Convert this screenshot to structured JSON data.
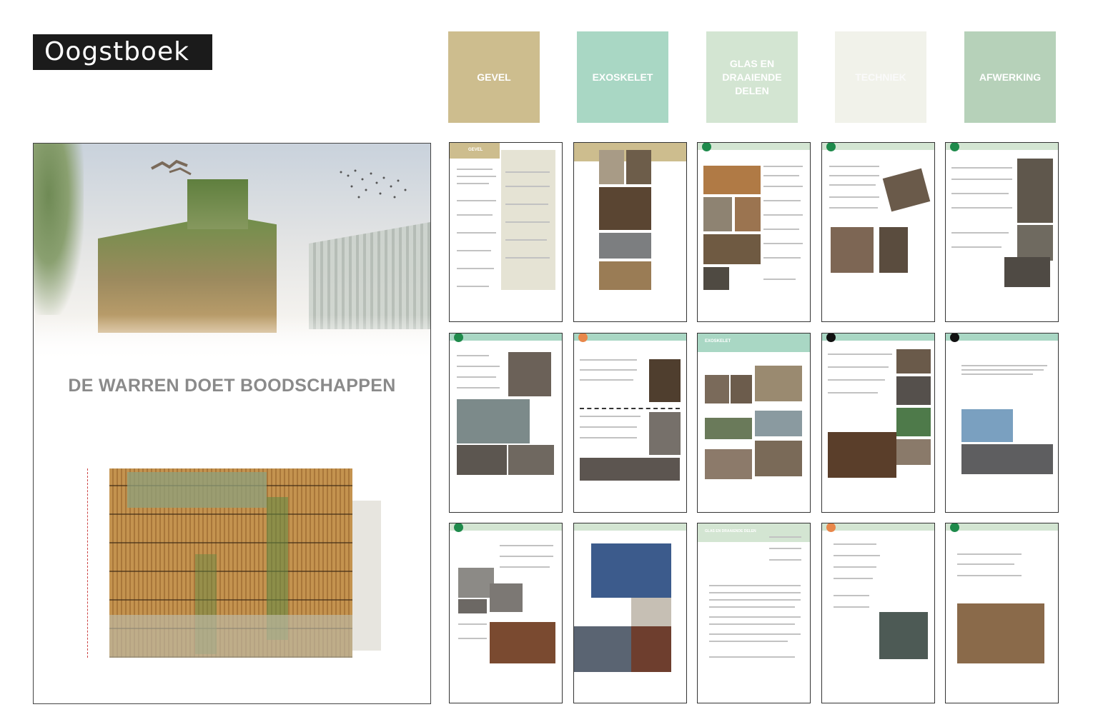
{
  "brand": {
    "logo_text": "Oogstboek"
  },
  "categories": [
    {
      "label": "GEVEL",
      "color": "#cdbd8e"
    },
    {
      "label": "EXOSKELET",
      "color": "#a9d7c4"
    },
    {
      "label": "GLAS EN DRAAIENDE DELEN",
      "color": "#d3e5d2"
    },
    {
      "label": "TECHNIEK",
      "color": "#f1f2ea"
    },
    {
      "label": "AFWERKING",
      "color": "#b6d1b9"
    }
  ],
  "poster": {
    "title": "DE WARREN DOET BOODSCHAPPEN"
  },
  "pages": {
    "gevel_label": "GEVEL",
    "exoskelet_label": "EXOSKELET",
    "glas_label": "GLAS EN DRAAIENDE DELEN"
  },
  "colors": {
    "green": "#1e8a4b",
    "orange": "#e8874a",
    "black": "#111111"
  }
}
